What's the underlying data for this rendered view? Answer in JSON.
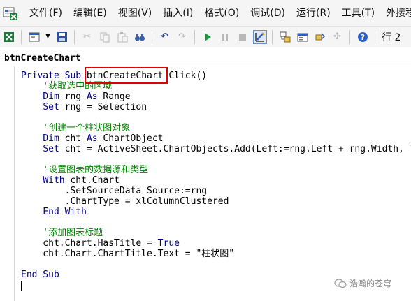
{
  "menu": {
    "items": [
      "文件(F)",
      "编辑(E)",
      "视图(V)",
      "插入(I)",
      "格式(O)",
      "调试(D)",
      "运行(R)",
      "工具(T)",
      "外接程"
    ]
  },
  "toolbar": {
    "line_indicator": "行 2"
  },
  "procedure_name": "btnCreateChart",
  "code": {
    "lines": [
      {
        "parts": [
          {
            "t": "Private Sub ",
            "c": "kw"
          },
          {
            "t": "btnCreateChart_Click()",
            "c": ""
          }
        ]
      },
      {
        "parts": [
          {
            "t": "    '获取选中的区域",
            "c": "cm"
          }
        ]
      },
      {
        "parts": [
          {
            "t": "    ",
            "c": ""
          },
          {
            "t": "Dim",
            "c": "kw"
          },
          {
            "t": " rng ",
            "c": ""
          },
          {
            "t": "As",
            "c": "kw"
          },
          {
            "t": " Range",
            "c": ""
          }
        ]
      },
      {
        "parts": [
          {
            "t": "    ",
            "c": ""
          },
          {
            "t": "Set",
            "c": "kw"
          },
          {
            "t": " rng = Selection",
            "c": ""
          }
        ]
      },
      {
        "parts": []
      },
      {
        "parts": [
          {
            "t": "    '创建一个柱状图对象",
            "c": "cm"
          }
        ]
      },
      {
        "parts": [
          {
            "t": "    ",
            "c": ""
          },
          {
            "t": "Dim",
            "c": "kw"
          },
          {
            "t": " cht ",
            "c": ""
          },
          {
            "t": "As",
            "c": "kw"
          },
          {
            "t": " ChartObject",
            "c": ""
          }
        ]
      },
      {
        "parts": [
          {
            "t": "    ",
            "c": ""
          },
          {
            "t": "Set",
            "c": "kw"
          },
          {
            "t": " cht = ActiveSheet.ChartObjects.Add(Left:=rng.Left + rng.Width, T",
            "c": ""
          }
        ]
      },
      {
        "parts": []
      },
      {
        "parts": [
          {
            "t": "    '设置图表的数据源和类型",
            "c": "cm"
          }
        ]
      },
      {
        "parts": [
          {
            "t": "    ",
            "c": ""
          },
          {
            "t": "With",
            "c": "kw"
          },
          {
            "t": " cht.Chart",
            "c": ""
          }
        ]
      },
      {
        "parts": [
          {
            "t": "        .SetSourceData Source:=rng",
            "c": ""
          }
        ]
      },
      {
        "parts": [
          {
            "t": "        .ChartType = xlColumnClustered",
            "c": ""
          }
        ]
      },
      {
        "parts": [
          {
            "t": "    ",
            "c": ""
          },
          {
            "t": "End With",
            "c": "kw"
          }
        ]
      },
      {
        "parts": []
      },
      {
        "parts": [
          {
            "t": "    '添加图表标题",
            "c": "cm"
          }
        ]
      },
      {
        "parts": [
          {
            "t": "    cht.Chart.HasTitle = ",
            "c": ""
          },
          {
            "t": "True",
            "c": "kw"
          }
        ]
      },
      {
        "parts": [
          {
            "t": "    cht.Chart.ChartTitle.Text = \"柱状图\"",
            "c": ""
          }
        ]
      },
      {
        "parts": []
      },
      {
        "parts": [
          {
            "t": "End Sub",
            "c": "kw"
          }
        ]
      }
    ]
  },
  "watermark": {
    "text": "浩瀚的苍穹"
  },
  "colors": {
    "keyword": "#00008b",
    "comment": "#008000",
    "highlight_box": "#e00000"
  }
}
